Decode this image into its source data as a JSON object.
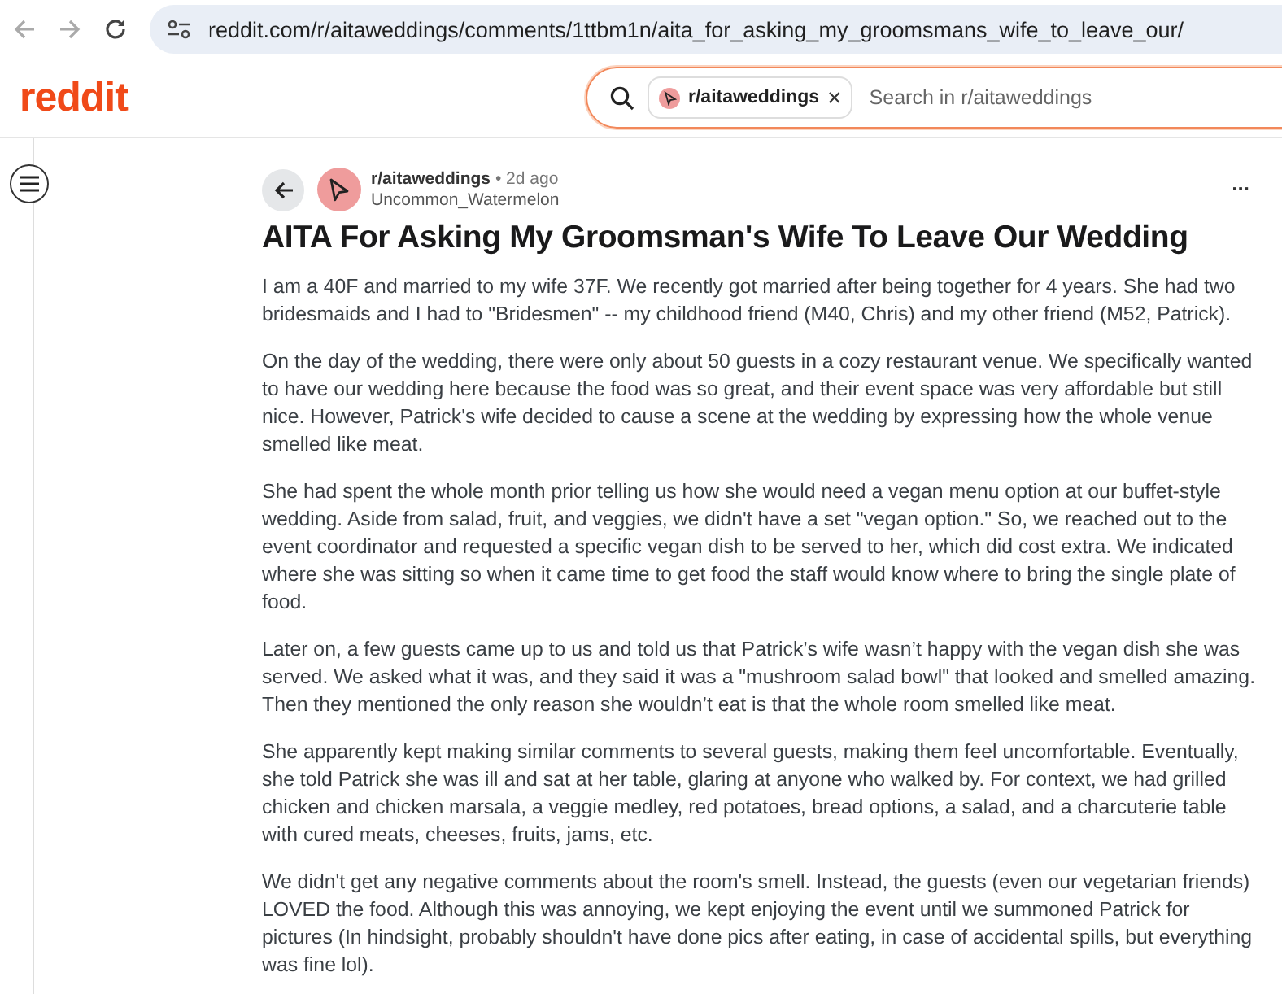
{
  "browser": {
    "url": "reddit.com/r/aitaweddings/comments/1ttbm1n/aita_for_asking_my_groomsmans_wife_to_leave_our/"
  },
  "header": {
    "logo": "reddit",
    "search": {
      "chip": "r/aitaweddings",
      "chip_close": "×",
      "placeholder": "Search in r/aitaweddings"
    }
  },
  "post": {
    "subreddit": "r/aitaweddings",
    "separator": "•",
    "age": "2d ago",
    "author": "Uncommon_Watermelon",
    "menu": "...",
    "title": "AITA For Asking My Groomsman's Wife To Leave Our Wedding",
    "paragraphs": [
      "I am a 40F and married to my wife 37F. We recently got married after being together for 4 years. She had two bridesmaids and I had to \"Bridesmen\" -- my childhood friend (M40, Chris) and my other friend (M52, Patrick).",
      "On the day of the wedding, there were only about 50 guests in a cozy restaurant venue. We specifically wanted to have our wedding here because the food was so great, and their event space was very affordable but still nice. However, Patrick's wife decided to cause a scene at the wedding by expressing how the whole venue smelled like meat.",
      "She had spent the whole month prior telling us how she would need a vegan menu option at our buffet-style wedding. Aside from salad, fruit, and veggies, we didn't have a set \"vegan option.\" So, we reached out to the event coordinator and requested a specific vegan dish to be served to her, which did cost extra. We indicated where she was sitting so when it came time to get food the staff would know where to bring the single plate of food.",
      "Later on, a few guests came up to us and told us that Patrick’s wife wasn’t happy with the vegan dish she was served. We asked what it was, and they said it was a \"mushroom salad bowl\" that looked and smelled amazing. Then they mentioned the only reason she wouldn’t eat is that the whole room smelled like meat.",
      "She apparently kept making similar comments to several guests, making them feel uncomfortable. Eventually, she told Patrick she was ill and sat at her table, glaring at anyone who walked by. For context, we had grilled chicken and chicken marsala, a veggie medley, red potatoes, bread options, a salad, and a charcuterie table with cured meats, cheeses, fruits, jams, etc.",
      "We didn't get any negative comments about the room's smell. Instead, the guests (even our vegetarian friends) LOVED the food. Although this was annoying, we kept enjoying the event until we summoned Patrick for pictures (In hindsight, probably shouldn't have done pics after eating, in case of accidental spills, but everything was fine lol)."
    ]
  }
}
